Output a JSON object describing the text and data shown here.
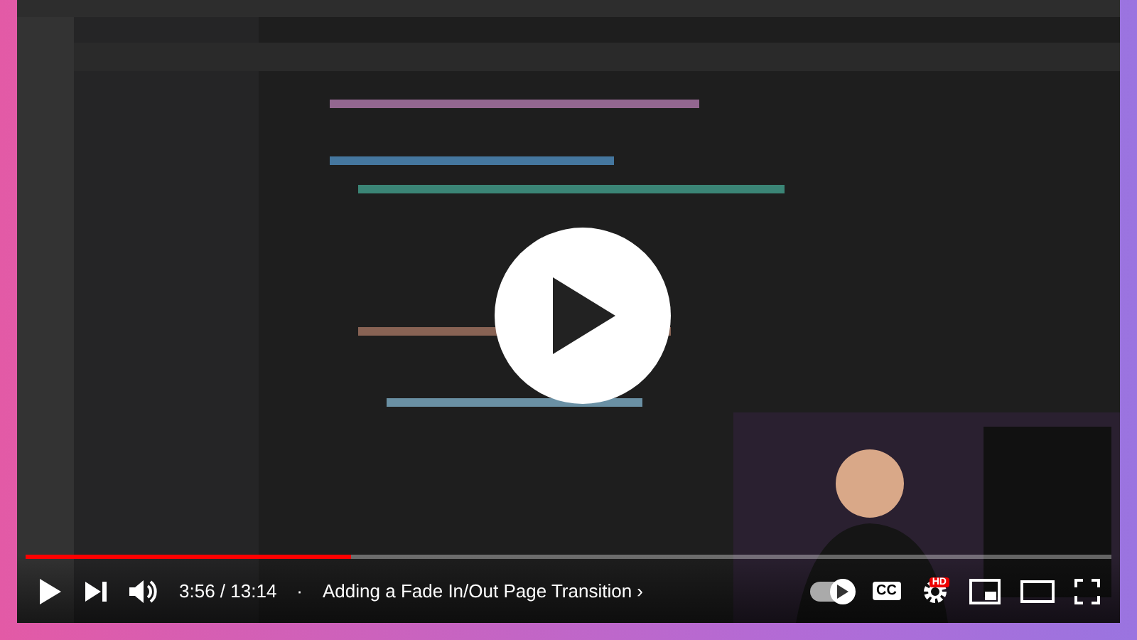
{
  "player": {
    "playing": false,
    "progress": {
      "level": 0.3
    },
    "time": "3:56 / 13:14",
    "separator": "·",
    "chapter": "Adding a Fade In/Out Page Transition",
    "chapter_arrow": "›",
    "autoplay": {
      "on": true
    },
    "captions_label": "CC",
    "quality_badge": "HD"
  }
}
